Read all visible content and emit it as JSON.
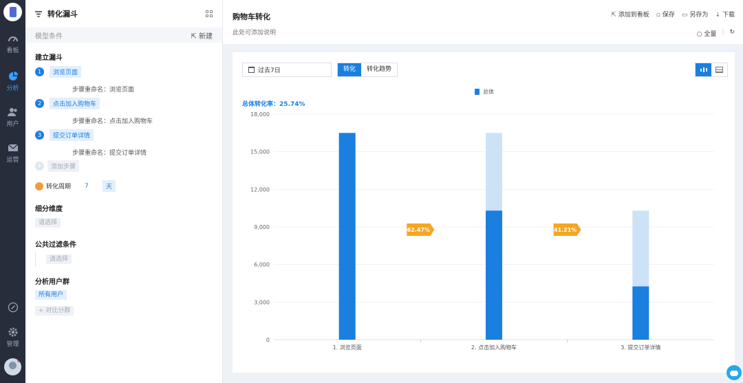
{
  "nav": {
    "items": [
      {
        "label": "看板",
        "icon": "dashboard-icon"
      },
      {
        "label": "分析",
        "icon": "pie-chart-icon"
      },
      {
        "label": "用户",
        "icon": "users-icon"
      },
      {
        "label": "运营",
        "icon": "mail-icon"
      },
      {
        "label": "管理",
        "icon": "gear-icon"
      }
    ]
  },
  "panel": {
    "title": "转化漏斗",
    "model_label": "模型条件",
    "new_label": "⇱ 新建",
    "build_title": "建立漏斗",
    "steps": [
      {
        "num": "1",
        "name": "浏览页面",
        "rename": "步骤重命名：浏览页面"
      },
      {
        "num": "2",
        "name": "点击加入购物车",
        "rename": "步骤重命名：点击加入购物车"
      },
      {
        "num": "3",
        "name": "提交订单详情",
        "rename": "步骤重命名：提交订单详情"
      }
    ],
    "add_step": "添加步骤",
    "period_label": "转化周期",
    "period_value": "7",
    "period_unit": "天",
    "dimension_title": "细分维度",
    "dimension_placeholder": "请选择",
    "filter_title": "公共过滤条件",
    "filter_placeholder": "请选择",
    "group_title": "分析用户群",
    "all_users": "所有用户",
    "compare_group": "+ 对比分群"
  },
  "main": {
    "title": "购物车转化",
    "description": "此处可添加说明",
    "toolbar": {
      "add_to_board": "添加到看板",
      "save": "保存",
      "save_as": "另存为",
      "download": "下载"
    },
    "fullscreen": "全量",
    "date_range": "过去7日",
    "tabs": [
      "转化",
      "转化趋势"
    ],
    "active_tab": "转化",
    "legend": "总体",
    "overall_rate": "总体转化率：25.74%"
  },
  "chart_data": {
    "type": "bar",
    "categories": [
      "1. 浏览页面",
      "2. 点击加入购物车",
      "3. 提交订单详情"
    ],
    "series": [
      {
        "name": "总体",
        "values": [
          16500,
          10300,
          4250
        ]
      }
    ],
    "previous_step_values": [
      16500,
      16500,
      10300
    ],
    "step_conversion_labels": [
      "62.47%",
      "41.21%"
    ],
    "ylim": [
      0,
      18000
    ],
    "yticks": [
      "0",
      "3,000",
      "6,000",
      "9,000",
      "12,000",
      "15,000",
      "18,000"
    ],
    "colors": {
      "bar": "#1b7fe0",
      "ghost": "#cce3f7",
      "rate": "#f5a623"
    },
    "grid": true,
    "legend_position": "top-center"
  }
}
